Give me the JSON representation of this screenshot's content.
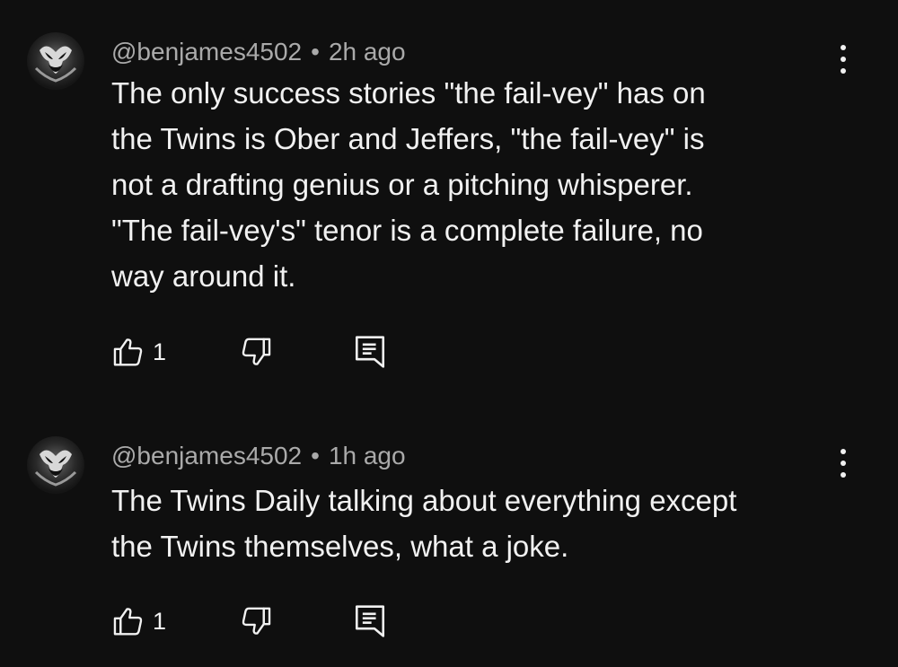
{
  "comments": [
    {
      "author": "@benjames4502",
      "separator": "•",
      "time": "2h ago",
      "text": "The only success stories \"the fail-vey\" has on\nthe Twins is Ober and Jeffers, \"the fail-vey\" is\nnot a drafting genius or a pitching whisperer.\n\"The fail-vey's\" tenor is a complete failure, no\nway around it.",
      "likes": "1"
    },
    {
      "author": "@benjames4502",
      "separator": "•",
      "time": "1h ago",
      "text": "The Twins Daily talking about everything except\nthe Twins themselves, what a joke.",
      "likes": "1"
    }
  ],
  "icons": {
    "like": "thumbs-up-icon",
    "dislike": "thumbs-down-icon",
    "reply": "reply-comment-icon",
    "menu": "more-vertical-icon",
    "avatar": "venom-avatar"
  },
  "colors": {
    "background": "#0f0f0f",
    "text": "#f1f1f1",
    "meta": "#aaaaaa"
  }
}
